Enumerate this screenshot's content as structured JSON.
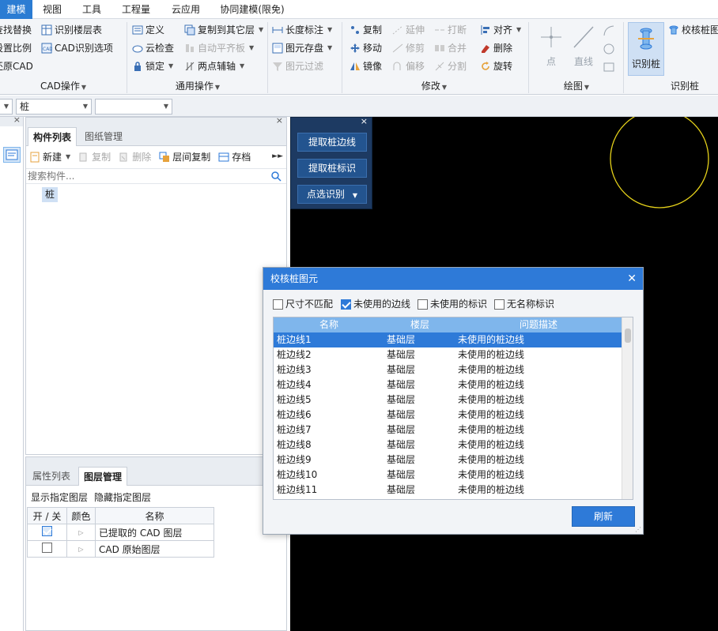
{
  "menu": {
    "items": [
      "建模",
      "视图",
      "工具",
      "工程量",
      "云应用",
      "协同建模(限免)"
    ],
    "active": "建模"
  },
  "ribbon": {
    "cad": {
      "items": [
        "查找替换",
        "识别楼层表",
        "设置比例",
        "CAD识别选项",
        "还原CAD"
      ],
      "group": "CAD操作"
    },
    "general": {
      "items": [
        "定义",
        "复制到其它层",
        "云检查",
        "自动平齐板",
        "锁定",
        "两点辅轴"
      ],
      "group": "通用操作"
    },
    "length": {
      "items": [
        "长度标注",
        "图元存盘",
        "图元过滤"
      ]
    },
    "modify": {
      "items": [
        "复制",
        "延伸",
        "打断",
        "对齐",
        "移动",
        "修剪",
        "合并",
        "删除",
        "镜像",
        "偏移",
        "分割",
        "旋转"
      ],
      "group": "修改"
    },
    "draw": {
      "items": [
        "点",
        "直线"
      ],
      "group": "绘图"
    },
    "pile": {
      "items": [
        "识别桩",
        "校核桩图元"
      ],
      "group": "识别桩"
    }
  },
  "toolbar2": {
    "floor_value": "",
    "type_value": "桩",
    "extra_value": ""
  },
  "component_panel": {
    "tabs": [
      "构件列表",
      "图纸管理"
    ],
    "buttons": [
      "新建",
      "复制",
      "删除",
      "层间复制",
      "存档"
    ],
    "search_placeholder": "搜索构件...",
    "tree_item": "桩"
  },
  "layer_panel": {
    "tabs": [
      "属性列表",
      "图层管理"
    ],
    "actions": [
      "显示指定图层",
      "隐藏指定图层"
    ],
    "headers": [
      "开 / 关",
      "颜色",
      "名称"
    ],
    "rows": [
      {
        "name": "已提取的 CAD 图层",
        "checked": true
      },
      {
        "name": "CAD 原始图层",
        "checked": false
      }
    ]
  },
  "float_panel": {
    "buttons": [
      "提取桩边线",
      "提取桩标识",
      "点选识别"
    ]
  },
  "dialog": {
    "title": "校核桩图元",
    "filters": [
      {
        "label": "尺寸不匹配",
        "checked": false
      },
      {
        "label": "未使用的边线",
        "checked": true
      },
      {
        "label": "未使用的标识",
        "checked": false
      },
      {
        "label": "无名称标识",
        "checked": false
      }
    ],
    "columns": [
      "名称",
      "楼层",
      "问题描述"
    ],
    "rows": [
      {
        "name": "桩边线1",
        "floor": "基础层",
        "desc": "未使用的桩边线"
      },
      {
        "name": "桩边线2",
        "floor": "基础层",
        "desc": "未使用的桩边线"
      },
      {
        "name": "桩边线3",
        "floor": "基础层",
        "desc": "未使用的桩边线"
      },
      {
        "name": "桩边线4",
        "floor": "基础层",
        "desc": "未使用的桩边线"
      },
      {
        "name": "桩边线5",
        "floor": "基础层",
        "desc": "未使用的桩边线"
      },
      {
        "name": "桩边线6",
        "floor": "基础层",
        "desc": "未使用的桩边线"
      },
      {
        "name": "桩边线7",
        "floor": "基础层",
        "desc": "未使用的桩边线"
      },
      {
        "name": "桩边线8",
        "floor": "基础层",
        "desc": "未使用的桩边线"
      },
      {
        "name": "桩边线9",
        "floor": "基础层",
        "desc": "未使用的桩边线"
      },
      {
        "name": "桩边线10",
        "floor": "基础层",
        "desc": "未使用的桩边线"
      },
      {
        "name": "桩边线11",
        "floor": "基础层",
        "desc": "未使用的桩边线"
      }
    ],
    "refresh": "刷新"
  },
  "colors": {
    "accent": "#2e7ad8",
    "canvas": "#000000",
    "circle": "#e6d21a"
  }
}
